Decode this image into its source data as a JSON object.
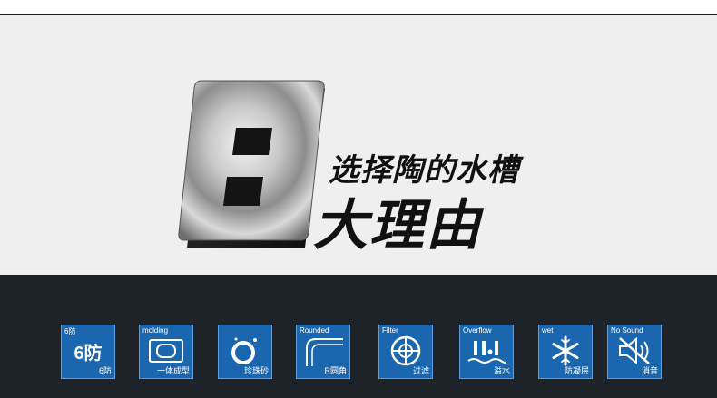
{
  "hero": {
    "numeral": "8",
    "line1": "选择陶的水槽",
    "line2": "大理由"
  },
  "features": [
    {
      "top_label": "6防",
      "main": "6防",
      "bottom_label": "6防",
      "icon": "six-protection-icon"
    },
    {
      "top_label": "molding",
      "bottom_label": "一体成型",
      "icon": "one-piece-molding-icon"
    },
    {
      "top_label": "",
      "bottom_label": "珍珠砂",
      "icon": "pearl-sand-icon"
    },
    {
      "top_label": "Rounded",
      "bottom_label": "R圆角",
      "icon": "rounded-corner-icon"
    },
    {
      "top_label": "Filter",
      "bottom_label": "过滤",
      "icon": "filter-icon"
    },
    {
      "top_label": "Overflow",
      "bottom_label": "溢水",
      "icon": "overflow-icon"
    },
    {
      "top_label": "wet",
      "bottom_label": "防凝层",
      "icon": "snowflake-icon"
    },
    {
      "top_label": "No Sound",
      "bottom_label": "消音",
      "icon": "mute-speaker-icon"
    }
  ],
  "colors": {
    "hero_bg": "#efefef",
    "bottom_bg": "#1d2329",
    "icon_bg": "#1a67b0",
    "icon_border": "#5c9fdc"
  }
}
